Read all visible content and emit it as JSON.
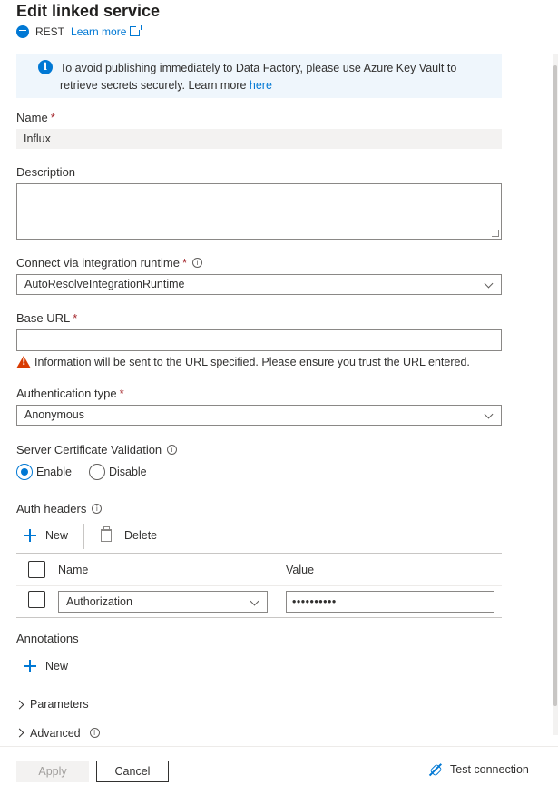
{
  "header": {
    "title": "Edit linked service",
    "connector": "REST",
    "learn_more": "Learn more"
  },
  "info_bar": {
    "text": "To avoid publishing immediately to Data Factory, please use Azure Key Vault to retrieve secrets securely. Learn more ",
    "link": "here"
  },
  "form": {
    "name": {
      "label": "Name",
      "value": "Influx"
    },
    "description": {
      "label": "Description",
      "value": ""
    },
    "runtime": {
      "label": "Connect via integration runtime",
      "value": "AutoResolveIntegrationRuntime"
    },
    "base_url": {
      "label": "Base URL",
      "value": "",
      "warning": "Information will be sent to the URL specified. Please ensure you trust the URL entered."
    },
    "auth_type": {
      "label": "Authentication type",
      "value": "Anonymous"
    },
    "cert_validation": {
      "label": "Server Certificate Validation",
      "options": [
        "Enable",
        "Disable"
      ],
      "selected": "Enable"
    },
    "required_marker": "*",
    "tooltip_glyph": "i"
  },
  "auth_headers": {
    "label": "Auth headers",
    "new_label": "New",
    "delete_label": "Delete",
    "columns": [
      "Name",
      "Value"
    ],
    "rows": [
      {
        "name": "Authorization",
        "value": "••••••••••"
      }
    ]
  },
  "annotations": {
    "label": "Annotations",
    "new_label": "New"
  },
  "sections": {
    "parameters": "Parameters",
    "advanced": "Advanced"
  },
  "footer": {
    "apply": "Apply",
    "cancel": "Cancel",
    "test_connection": "Test connection"
  },
  "colors": {
    "accent": "#0078d4",
    "required": "#a4262c",
    "warning": "#d83b01",
    "info_bg": "#eff6fc"
  }
}
